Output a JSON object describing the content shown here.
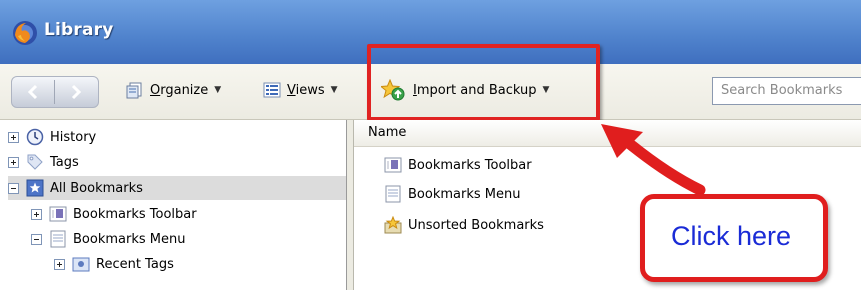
{
  "window": {
    "title": "Library",
    "logo": "firefox-logo-icon"
  },
  "toolbar": {
    "back_icon": "back-arrow-icon",
    "forward_icon": "forward-arrow-icon",
    "organize_label": "Organize",
    "views_label": "Views",
    "import_label": "Import and Backup",
    "search_placeholder": "Search Bookmarks"
  },
  "tree": {
    "items": [
      {
        "label": "History",
        "icon": "history-clock-icon",
        "expander": "plus",
        "level": 0
      },
      {
        "label": "Tags",
        "icon": "tag-icon",
        "expander": "plus",
        "level": 0
      },
      {
        "label": "All Bookmarks",
        "icon": "star-folder-icon",
        "expander": "minus",
        "level": 0,
        "selected": true
      },
      {
        "label": "Bookmarks Toolbar",
        "icon": "toolbar-folder-icon",
        "expander": "plus",
        "level": 1
      },
      {
        "label": "Bookmarks Menu",
        "icon": "menu-folder-icon",
        "expander": "minus",
        "level": 1
      },
      {
        "label": "Recent Tags",
        "icon": "tag-folder-icon",
        "expander": "plus",
        "level": 2
      }
    ]
  },
  "list": {
    "column_header": "Name",
    "items": [
      {
        "label": "Bookmarks Toolbar",
        "icon": "toolbar-folder-icon"
      },
      {
        "label": "Bookmarks Menu",
        "icon": "menu-folder-icon"
      },
      {
        "label": "Unsorted Bookmarks",
        "icon": "unsorted-bookmarks-icon"
      }
    ]
  },
  "annotation": {
    "callout_text": "Click here",
    "color": "#e02322",
    "text_color": "#1a2bd6"
  }
}
